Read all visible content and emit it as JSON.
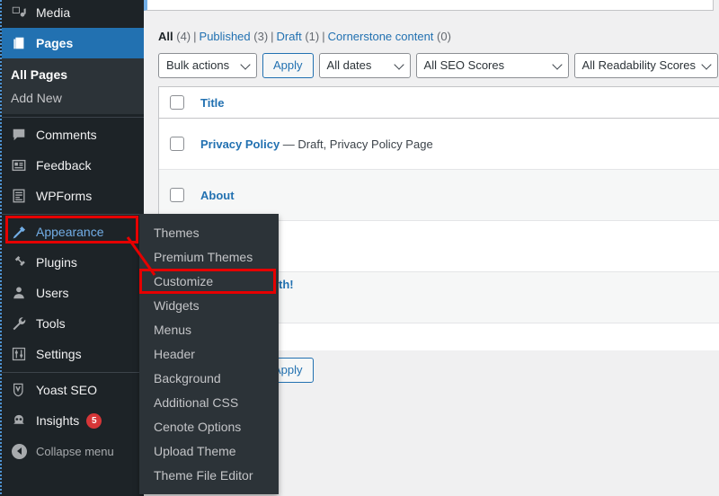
{
  "views": [
    {
      "label": "All",
      "count": "(4)",
      "current": true
    },
    {
      "label": "Published",
      "count": "(3)",
      "current": false
    },
    {
      "label": "Draft",
      "count": "(1)",
      "current": false
    },
    {
      "label": "Cornerstone content",
      "count": "(0)",
      "current": false
    }
  ],
  "view_separator": "|",
  "filters": {
    "bulk_actions": "Bulk actions",
    "apply_top": "Apply",
    "all_dates": "All dates",
    "seo_scores": "All SEO Scores",
    "readability_scores": "All Readability Scores",
    "apply_bottom": "Apply"
  },
  "table": {
    "header": {
      "title": "Title"
    },
    "rows": [
      {
        "title": "Privacy Policy",
        "status": " — Draft, Privacy Policy Page"
      },
      {
        "title": "About",
        "status": ""
      },
      {
        "title": "",
        "status": ""
      }
    ]
  },
  "partial_text": "th!",
  "sidebar": {
    "items": [
      {
        "id": "media",
        "label": "Media",
        "icon": "media-icon",
        "state": "default"
      },
      {
        "id": "pages",
        "label": "Pages",
        "icon": "pages-icon",
        "state": "current"
      },
      {
        "id": "comments",
        "label": "Comments",
        "icon": "comments-icon",
        "state": "default"
      },
      {
        "id": "feedback",
        "label": "Feedback",
        "icon": "feedback-icon",
        "state": "default"
      },
      {
        "id": "wpforms",
        "label": "WPForms",
        "icon": "wpforms-icon",
        "state": "default"
      },
      {
        "id": "appearance",
        "label": "Appearance",
        "icon": "appearance-icon",
        "state": "hovered"
      },
      {
        "id": "plugins",
        "label": "Plugins",
        "icon": "plugins-icon",
        "state": "default"
      },
      {
        "id": "users",
        "label": "Users",
        "icon": "users-icon",
        "state": "default"
      },
      {
        "id": "tools",
        "label": "Tools",
        "icon": "tools-icon",
        "state": "default"
      },
      {
        "id": "settings",
        "label": "Settings",
        "icon": "settings-icon",
        "state": "default"
      },
      {
        "id": "yoast-seo",
        "label": "Yoast SEO",
        "icon": "yoast-icon",
        "state": "default"
      },
      {
        "id": "insights",
        "label": "Insights",
        "icon": "insights-icon",
        "state": "default",
        "badge": "5"
      }
    ],
    "pages_submenu": [
      {
        "label": "All Pages",
        "current": true
      },
      {
        "label": "Add New",
        "current": false
      }
    ],
    "collapse": {
      "label": "Collapse menu",
      "icon": "collapse-arrow-icon"
    }
  },
  "appearance_flyout": {
    "items": [
      "Themes",
      "Premium Themes",
      "Customize",
      "Widgets",
      "Menus",
      "Header",
      "Background",
      "Additional CSS",
      "Cenote Options",
      "Upload Theme",
      "Theme File Editor"
    ],
    "highlighted": "Customize"
  },
  "colors": {
    "sidebar_bg": "#1d2327",
    "submenu_bg": "#2c3338",
    "current_blue": "#2271b1",
    "link_blue": "#2271b1",
    "hover_blue": "#72aee6",
    "annotation_red": "#e60000",
    "badge_red": "#d63638",
    "content_bg": "#f0f0f1"
  }
}
